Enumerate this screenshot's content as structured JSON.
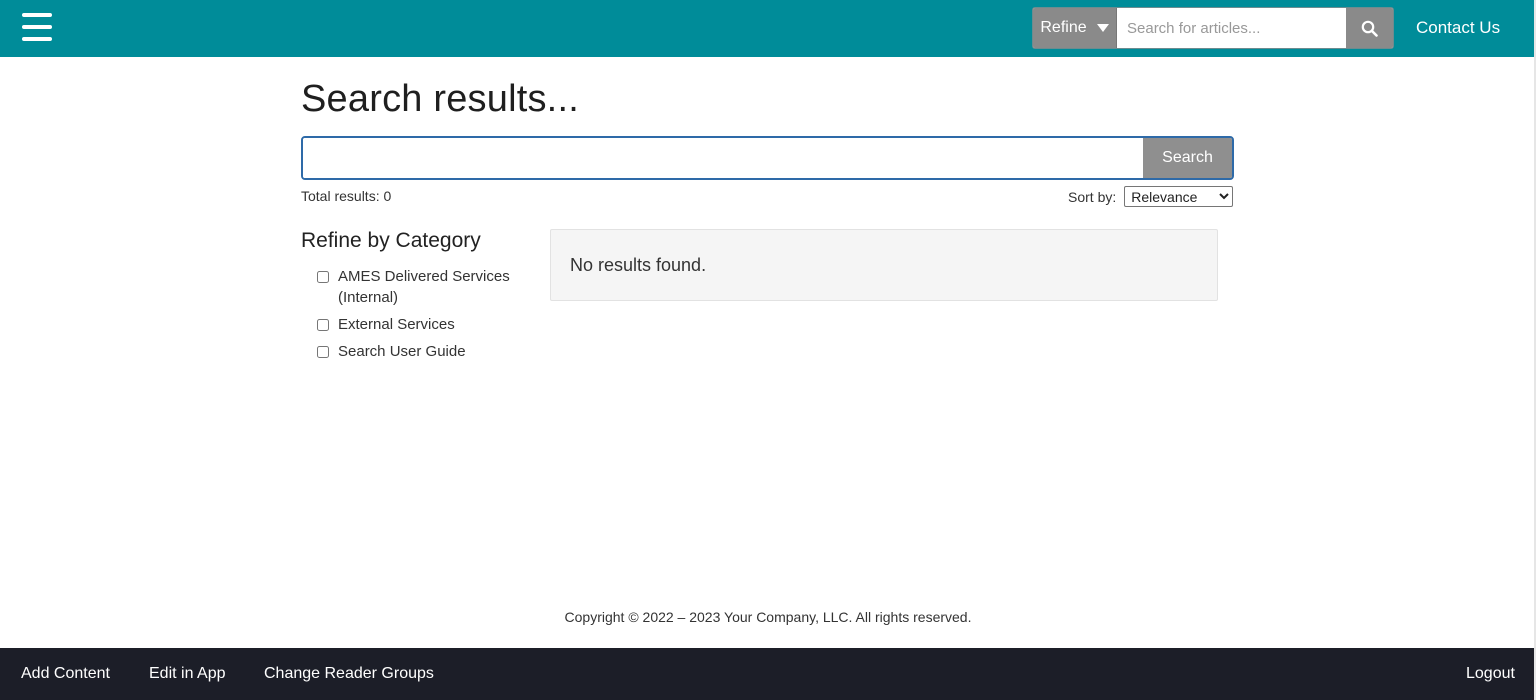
{
  "header": {
    "refine_label": "Refine",
    "search_placeholder": "Search for articles...",
    "contact_label": "Contact Us"
  },
  "main": {
    "title": "Search results...",
    "search_value": "",
    "search_button": "Search",
    "total_results": "Total results: 0",
    "sort_label": "Sort by:",
    "sort_selected": "Relevance",
    "no_results": "No results found."
  },
  "refine": {
    "heading": "Refine by Category",
    "categories": [
      {
        "label": "AMES Delivered Services (Internal)",
        "checked": false
      },
      {
        "label": "External Services",
        "checked": false
      },
      {
        "label": "Search User Guide",
        "checked": false
      }
    ]
  },
  "footer": {
    "copyright": "Copyright © 2022 – 2023 Your Company, LLC. All rights reserved."
  },
  "bottombar": {
    "add_content": "Add Content",
    "edit_in_app": "Edit in App",
    "change_reader_groups": "Change Reader Groups",
    "logout": "Logout"
  },
  "colors": {
    "header_bg": "#008c99",
    "bottombar_bg": "#1c1e28",
    "button_gray": "#8f8f8f",
    "search_border": "#2e6aa8"
  },
  "icons": {
    "menu": "hamburger-menu-icon",
    "search": "search-icon",
    "refine_caret": "caret-down-icon"
  }
}
